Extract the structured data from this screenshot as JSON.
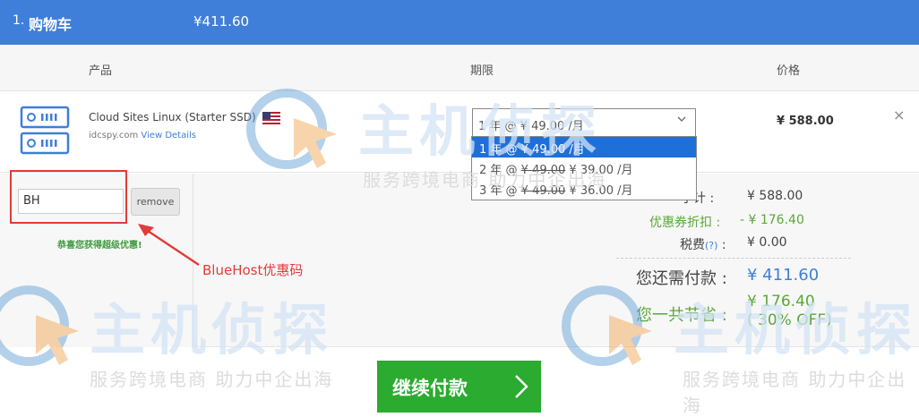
{
  "cart": {
    "step": "1.",
    "title": "购物车",
    "total": "¥411.60"
  },
  "columns": {
    "product": "产品",
    "period": "期限",
    "price": "价格"
  },
  "product": {
    "name": "Cloud Sites Linux (Starter SSD)",
    "domain": "idcspy.com",
    "view_details": "View Details",
    "price": "¥ 588.00",
    "remove_x": "×"
  },
  "period": {
    "selected": "1 年 @ ¥ 49.00 /月",
    "options": [
      {
        "prefix": "1 年 @ ",
        "old": "",
        "new": "¥ 49.00 /月"
      },
      {
        "prefix": "2 年 @ ",
        "old": "¥ 49.00",
        "new": " ¥ 39.00 /月"
      },
      {
        "prefix": "3 年 @ ",
        "old": "¥ 49.00",
        "new": " ¥ 36.00 /月"
      }
    ]
  },
  "coupon": {
    "value": "BH",
    "remove_label": "remove",
    "congrats": "恭喜您获得超级优惠!",
    "annotation": "BlueHost优惠码"
  },
  "summary": {
    "subtotal_label": "小计 :",
    "subtotal_value": "¥ 588.00",
    "discount_label": "优惠券折扣 :",
    "discount_value": "- ¥ 176.40",
    "tax_label": "税费",
    "tax_q": "(?)",
    "tax_colon": " :",
    "tax_value": "¥ 0.00",
    "due_label": "您还需付款 :",
    "due_value": "¥ 411.60",
    "saved_label": "您一共节省 :",
    "saved_value": "¥ 176.40",
    "saved_pct": "( 30% OFF)"
  },
  "continue_label": "继续付款",
  "watermark": {
    "brand": "主机侦探",
    "slogan": "服务跨境电商 助力中企出海"
  },
  "colors": {
    "header_blue": "#3f7fd9",
    "select_blue": "#1f6fd9",
    "button_green": "#2bab2f",
    "discount_green": "#5aa83a",
    "annotation_red": "#e23b3b"
  }
}
